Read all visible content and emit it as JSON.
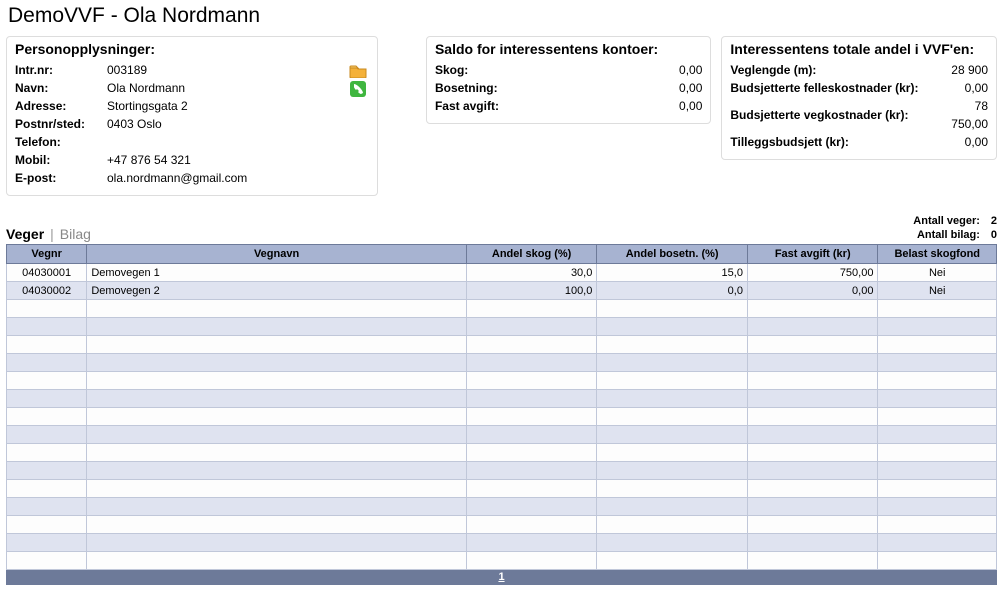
{
  "title": "DemoVVF - Ola Nordmann",
  "person": {
    "heading": "Personopplysninger:",
    "labels": {
      "intrnr": "Intr.nr:",
      "navn": "Navn:",
      "adresse": "Adresse:",
      "poststed": "Postnr/sted:",
      "telefon": "Telefon:",
      "mobil": "Mobil:",
      "epost": "E-post:"
    },
    "values": {
      "intrnr": "003189",
      "navn": "Ola Nordmann",
      "adresse": "Stortingsgata 2",
      "poststed": "0403 Oslo",
      "telefon": "",
      "mobil": "+47 876 54 321",
      "epost": "ola.nordmann@gmail.com"
    }
  },
  "saldo": {
    "heading": "Saldo for interessentens kontoer:",
    "labels": {
      "skog": "Skog:",
      "bosetning": "Bosetning:",
      "fast": "Fast avgift:"
    },
    "values": {
      "skog": "0,00",
      "bosetning": "0,00",
      "fast": "0,00"
    }
  },
  "totale": {
    "heading": "Interessentens totale andel i VVF'en:",
    "labels": {
      "veglengde": "Veglengde (m):",
      "felles": "Budsjetterte felleskostnader (kr):",
      "veg": "Budsjetterte vegkostnader (kr):",
      "tillegg": "Tilleggsbudsjett (kr):"
    },
    "values": {
      "veglengde": "28 900",
      "felles": "0,00",
      "veg": "78 750,00",
      "tillegg": "0,00"
    }
  },
  "tabs": {
    "veger": "Veger",
    "bilag": "Bilag"
  },
  "counts": {
    "veger_label": "Antall veger:",
    "veger_value": "2",
    "bilag_label": "Antall bilag:",
    "bilag_value": "0"
  },
  "grid": {
    "headers": {
      "vegnr": "Vegnr",
      "vegnavn": "Vegnavn",
      "skog": "Andel skog (%)",
      "bosetn": "Andel bosetn. (%)",
      "avgift": "Fast avgift (kr)",
      "belast": "Belast skogfond"
    },
    "rows": [
      {
        "vegnr": "04030001",
        "vegnavn": "Demovegen 1",
        "skog": "30,0",
        "bosetn": "15,0",
        "avgift": "750,00",
        "belast": "Nei"
      },
      {
        "vegnr": "04030002",
        "vegnavn": "Demovegen 2",
        "skog": "100,0",
        "bosetn": "0,0",
        "avgift": "0,00",
        "belast": "Nei"
      }
    ],
    "empty_rows": 15,
    "page": "1"
  }
}
